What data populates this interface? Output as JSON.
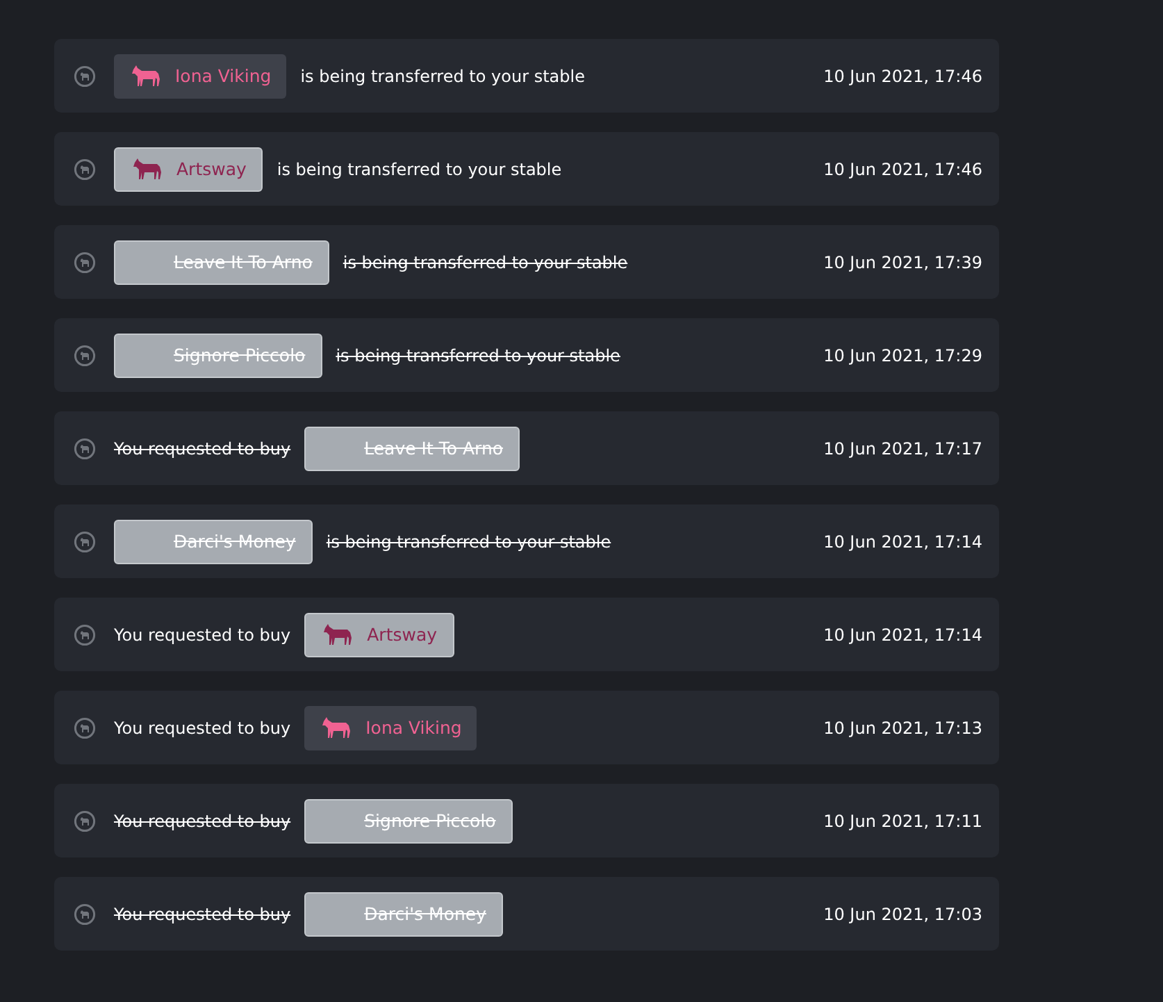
{
  "events": [
    {
      "kind": "transfer",
      "cancelled": false,
      "horse": {
        "name": "Iona Viking",
        "kind": "dark",
        "color": "#f06292"
      },
      "text": "is being transferred to your stable",
      "time": "10 Jun 2021, 17:46"
    },
    {
      "kind": "transfer",
      "cancelled": false,
      "horse": {
        "name": "Artsway",
        "kind": "light",
        "color": "#8e2450"
      },
      "text": "is being transferred to your stable",
      "time": "10 Jun 2021, 17:46"
    },
    {
      "kind": "transfer",
      "cancelled": true,
      "horse": {
        "name": "Leave It To Arno",
        "kind": "light"
      },
      "text": "is being transferred to your stable",
      "time": "10 Jun 2021, 17:39"
    },
    {
      "kind": "transfer",
      "cancelled": true,
      "horse": {
        "name": "Signore Piccolo",
        "kind": "light"
      },
      "text": "is being transferred to your stable",
      "time": "10 Jun 2021, 17:29"
    },
    {
      "kind": "request",
      "cancelled": true,
      "horse": {
        "name": "Leave It To Arno",
        "kind": "light"
      },
      "text": "You requested to buy",
      "time": "10 Jun 2021, 17:17"
    },
    {
      "kind": "transfer",
      "cancelled": true,
      "horse": {
        "name": "Darci's Money",
        "kind": "light"
      },
      "text": "is being transferred to your stable",
      "time": "10 Jun 2021, 17:14"
    },
    {
      "kind": "request",
      "cancelled": false,
      "horse": {
        "name": "Artsway",
        "kind": "light",
        "color": "#8e2450"
      },
      "text": "You requested to buy",
      "time": "10 Jun 2021, 17:14"
    },
    {
      "kind": "request",
      "cancelled": false,
      "horse": {
        "name": "Iona Viking",
        "kind": "dark",
        "color": "#f06292"
      },
      "text": "You requested to buy",
      "time": "10 Jun 2021, 17:13"
    },
    {
      "kind": "request",
      "cancelled": true,
      "horse": {
        "name": "Signore Piccolo",
        "kind": "light"
      },
      "text": "You requested to buy",
      "time": "10 Jun 2021, 17:11"
    },
    {
      "kind": "request",
      "cancelled": true,
      "horse": {
        "name": "Darci's Money",
        "kind": "light"
      },
      "text": "You requested to buy",
      "time": "10 Jun 2021, 17:03"
    }
  ]
}
